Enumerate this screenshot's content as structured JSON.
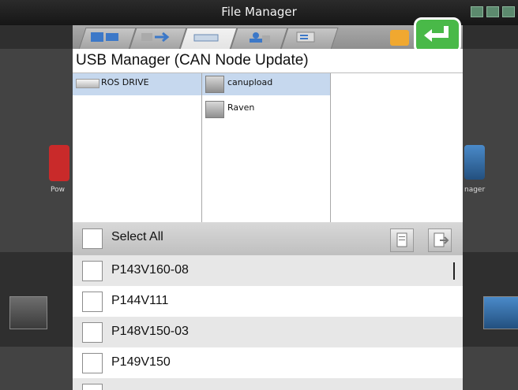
{
  "window_title": "File Manager",
  "colors": {
    "accent": "#49b948",
    "selection": "#c6d8ee",
    "header_bg": "#ffffff"
  },
  "tabs": [
    {
      "icon": "monitor-icon"
    },
    {
      "icon": "transfer-icon"
    },
    {
      "icon": "usb-drive-icon",
      "active": true
    },
    {
      "icon": "user-transfer-icon"
    },
    {
      "icon": "settings-panel-icon"
    }
  ],
  "header": {
    "title": "USB Manager (CAN Node Update)"
  },
  "drives": [
    {
      "label": "ROS DRIVE",
      "selected": true
    }
  ],
  "folders": [
    {
      "label": "canupload",
      "selected": true
    },
    {
      "label": "Raven",
      "selected": false
    }
  ],
  "select_all_label": "Select All",
  "files": [
    {
      "label": "P143V160-08"
    },
    {
      "label": "P144V111"
    },
    {
      "label": "P148V150-03"
    },
    {
      "label": "P149V150"
    },
    {
      "label": ""
    }
  ],
  "background": {
    "left_label": "Pow",
    "right_label": "nager"
  }
}
